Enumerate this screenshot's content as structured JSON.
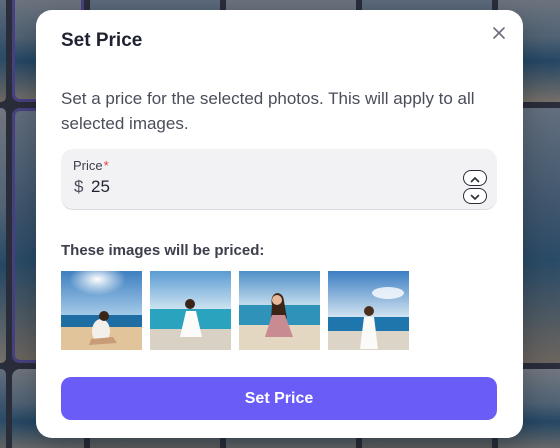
{
  "modal": {
    "title": "Set Price",
    "description": "Set a price for the selected photos. This will apply to all selected images.",
    "price_field": {
      "label": "Price",
      "required_mark": "*",
      "currency_symbol": "$",
      "value": "25"
    },
    "images_section_title": "These images will be priced:",
    "thumbnails": [
      {
        "icon": "beach-photo-sitting-woman"
      },
      {
        "icon": "beach-photo-white-dress"
      },
      {
        "icon": "beach-photo-walking-woman"
      },
      {
        "icon": "beach-photo-sea-view"
      }
    ],
    "submit_label": "Set Price",
    "colors": {
      "accent": "#6a5cf6",
      "required": "#e23b3b"
    }
  }
}
